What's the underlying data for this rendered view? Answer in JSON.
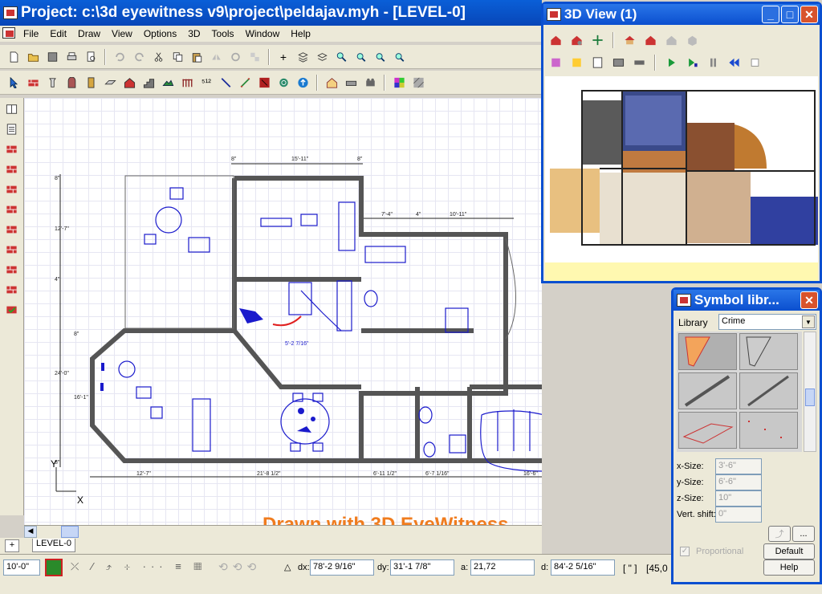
{
  "app": {
    "title": "Project: c:\\3d eyewitness v9\\project\\peldajav.myh - [LEVEL-0]"
  },
  "menu": [
    "File",
    "Edit",
    "Draw",
    "View",
    "Options",
    "3D",
    "Tools",
    "Window",
    "Help"
  ],
  "drawing": {
    "watermark": "Drawn with 3D EyeWitness",
    "dims_top": [
      "8\"",
      "15'-11\"",
      "8\""
    ],
    "dims_mid": [
      "7'-4\"",
      "4\"",
      "10'-11\""
    ],
    "dims_bottom": [
      "12'-7\"",
      "21'-8 1/2\"",
      "6'-11 1/2\"",
      "6'-7 1/16\"",
      "16'-6\""
    ],
    "dims_left": [
      "8\"",
      "12'-7\"",
      "4\"",
      "8\"",
      "24'-0\"",
      "16'-1\"",
      "8\""
    ],
    "room_label": "5'-2 7/16\"",
    "axis_x": "X",
    "axis_y": "Y"
  },
  "tabs": {
    "add": "+",
    "level": "LEVEL-0"
  },
  "status": {
    "scale": "10'-0\"",
    "dx_label": "dx:",
    "dx": "78'-2 9/16\"",
    "dy_label": "dy:",
    "dy": "31'-1 7/8\"",
    "a_label": "a:",
    "a": "21,72",
    "d_label": "d:",
    "d": "84'-2 5/16\"",
    "unit": "[ \" ]",
    "angle": "[45,0"
  },
  "view3d": {
    "title": "3D View (1)"
  },
  "symbol_library": {
    "title": "Symbol libr...",
    "library_label": "Library",
    "library_value": "Crime",
    "x_label": "x-Size:",
    "x_value": "3'-6\"",
    "y_label": "y-Size:",
    "y_value": "6'-6\"",
    "z_label": "z-Size:",
    "z_value": "10\"",
    "vs_label": "Vert. shift:",
    "vs_value": "0\"",
    "proportional": "Proportional",
    "default_btn": "Default",
    "help_btn": "Help",
    "more_btn": "..."
  },
  "colors": {
    "titlebar": "#0a5fd8",
    "wall": "#5a5a5a",
    "furniture": "#1a1acc",
    "watermark": "#f07c1e"
  }
}
